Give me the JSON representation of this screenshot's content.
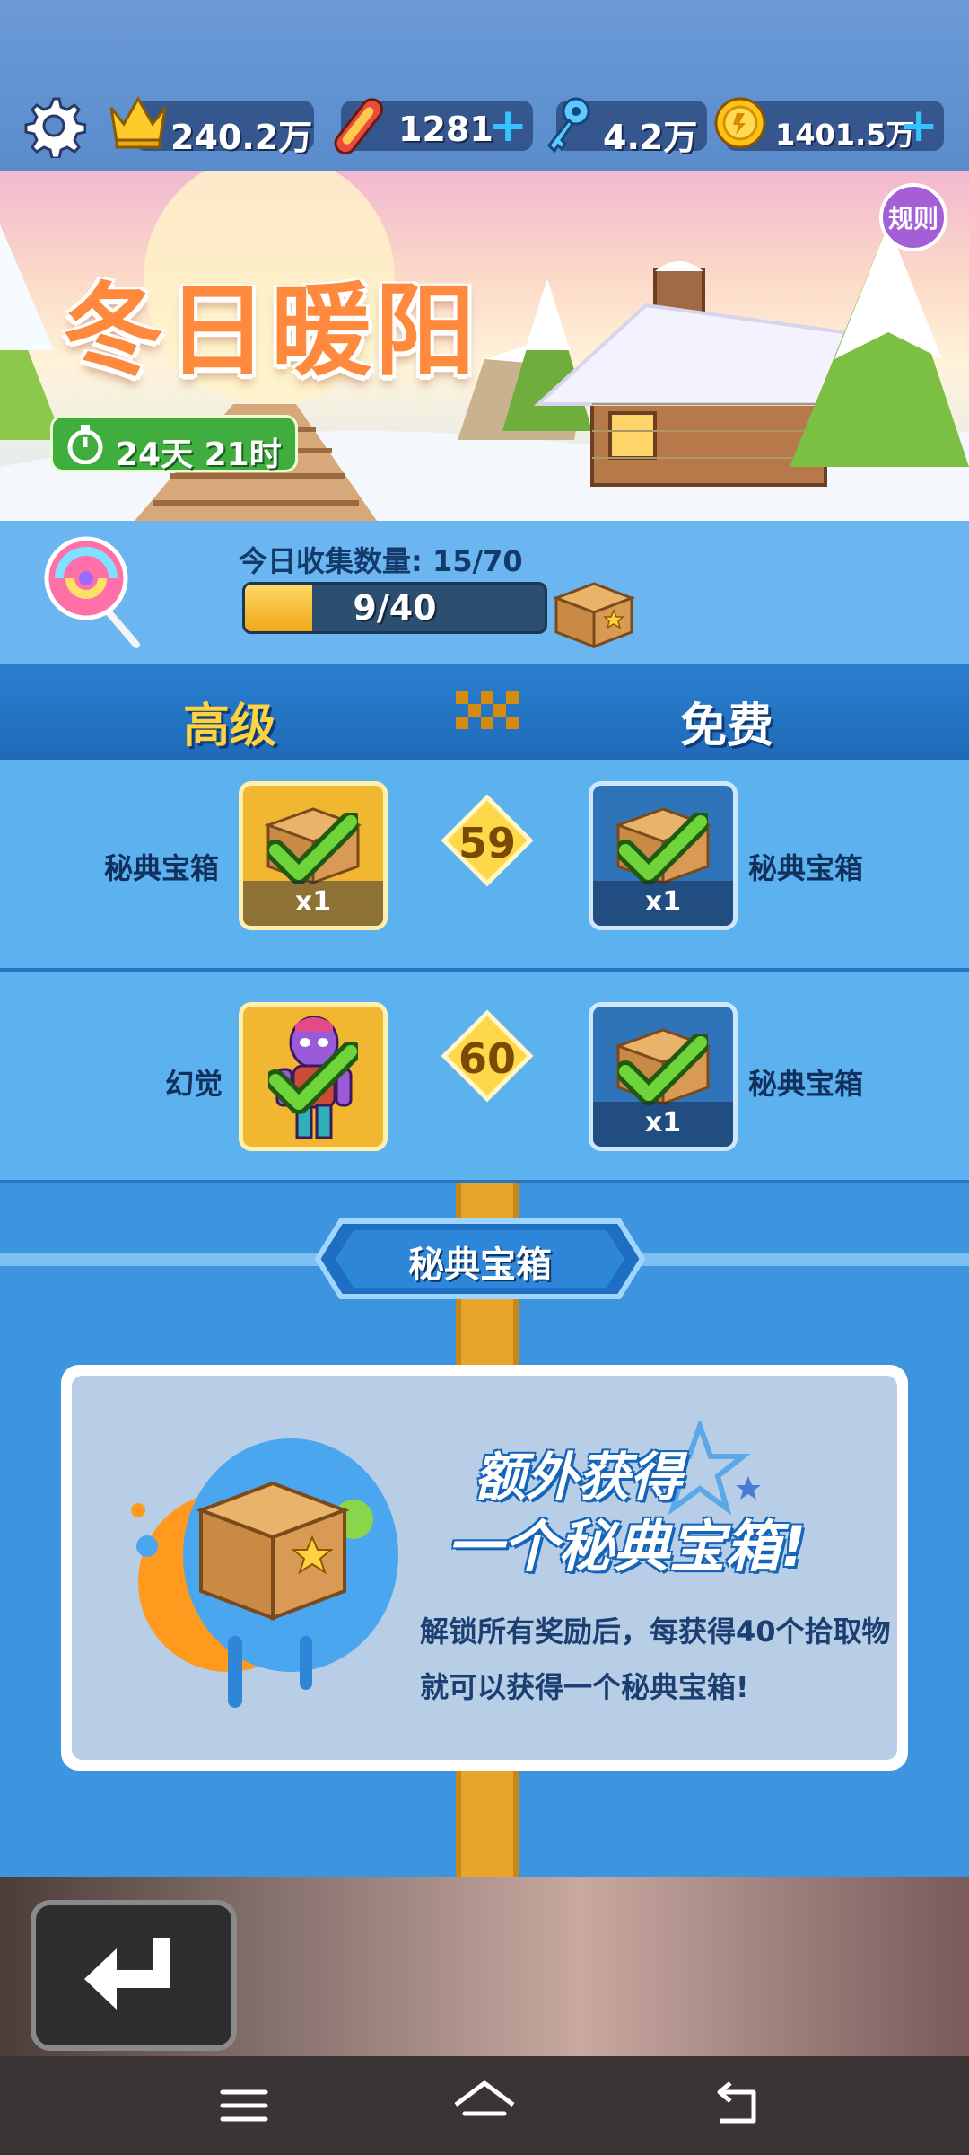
{
  "topbar": {
    "crowns": "240.2万",
    "boards": "1281",
    "keys": "4.2万",
    "coins": "1401.5万",
    "plus": "+"
  },
  "banner": {
    "title": "冬日暖阳",
    "rules_label": "规则",
    "timer": "24天 21时"
  },
  "collect": {
    "today_label": "今日收集数量: 15/70",
    "progress_text": "9/40",
    "progress_value": 9,
    "progress_max": 40
  },
  "columns": {
    "premium": "高级",
    "free": "免费"
  },
  "rows": [
    {
      "level": "59",
      "premium_label": "秘典宝箱",
      "premium_qty": "x1",
      "free_label": "秘典宝箱",
      "free_qty": "x1"
    },
    {
      "level": "60",
      "premium_label": "幻觉",
      "premium_qty": "",
      "free_label": "秘典宝箱",
      "free_qty": "x1"
    }
  ],
  "section": {
    "title": "秘典宝箱"
  },
  "info": {
    "headline1": "额外获得",
    "headline2": "一个秘典宝箱!",
    "description": "解锁所有奖励后，每获得40个拾取物就可以获得一个秘典宝箱!"
  },
  "bottom": {
    "menu_label": "菜单"
  },
  "colors": {
    "accent_gold": "#f2b731",
    "track_blue": "#3d95e0",
    "road_orange": "#e7a52a"
  }
}
